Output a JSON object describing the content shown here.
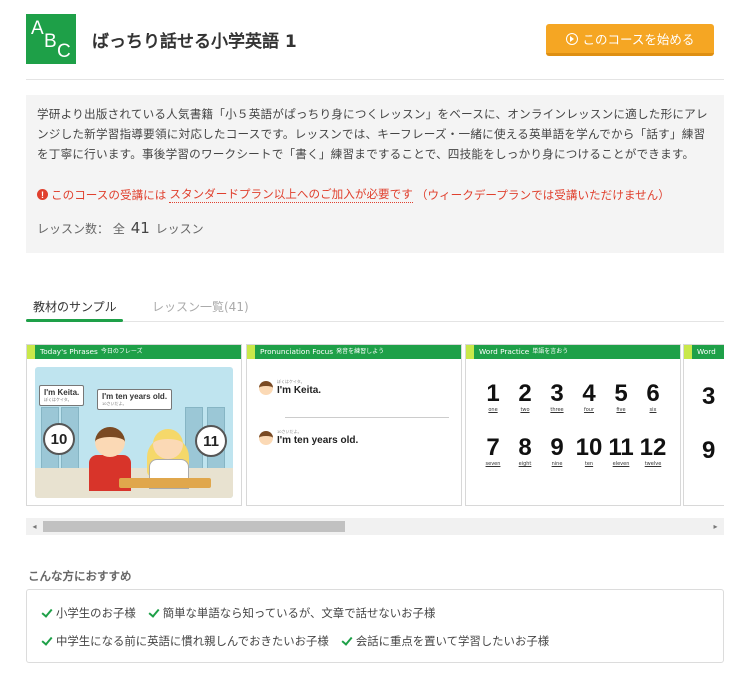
{
  "course": {
    "logo_letters": [
      "A",
      "B",
      "C"
    ],
    "title": "ばっちり話せる小学英語 1",
    "start_button": "このコースを始める",
    "description": "学研より出版されている人気書籍「小５英語がぱっちり身につくレッスン」をベースに、オンラインレッスンに適した形にアレンジした新学習指導要領に対応したコースです。レッスンでは、キーフレーズ・一緒に使える英単語を学んでから「話す」練習を丁寧に行います。事後学習のワークシートで「書く」練習まですることで、四技能をしっかり身につけることができます。",
    "notice_prefix": "このコースの受講には",
    "notice_link": "スタンダードプラン以上へのご加入が必要です",
    "notice_suffix": "（ウィークデープランでは受講いただけません）",
    "lessons_label": "レッスン数：",
    "lessons_prefix": "全",
    "lessons_count": "41",
    "lessons_unit": "レッスン"
  },
  "tabs": {
    "sample": "教材のサンプル",
    "list": "レッスン一覧(41)"
  },
  "slides": [
    {
      "title": "Today's Phrases",
      "subtitle": "今日のフレーズ",
      "bubble1": "I'm Keita.",
      "bubble1_ruby": "ぼくはケイタ。",
      "bubble2": "I'm ten years old.",
      "bubble2_ruby": "10さいだよ。",
      "circle1": "10",
      "circle2": "11"
    },
    {
      "title": "Pronunciation Focus",
      "subtitle": "発音を練習しよう",
      "line1": "I'm Keita.",
      "line1_ruby": "ぼくはケイタ。",
      "line2": "I'm ten years old.",
      "line2_ruby": "10さいだよ。"
    },
    {
      "title": "Word Practice",
      "subtitle": "単語を言おう",
      "row1": [
        {
          "n": "1",
          "w": "one"
        },
        {
          "n": "2",
          "w": "two"
        },
        {
          "n": "3",
          "w": "three"
        },
        {
          "n": "4",
          "w": "four"
        },
        {
          "n": "5",
          "w": "five"
        },
        {
          "n": "6",
          "w": "six"
        }
      ],
      "row2": [
        {
          "n": "7",
          "w": "seven"
        },
        {
          "n": "8",
          "w": "eight"
        },
        {
          "n": "9",
          "w": "nine"
        },
        {
          "n": "10",
          "w": "ten"
        },
        {
          "n": "11",
          "w": "eleven"
        },
        {
          "n": "12",
          "w": "twelve"
        }
      ]
    },
    {
      "title": "Word",
      "n1": "3",
      "n2": "9"
    }
  ],
  "recommend": {
    "title": "こんな方におすすめ",
    "items": [
      "小学生のお子様",
      "簡単な単語なら知っているが、文章で話せないお子様",
      "中学生になる前に英語に慣れ親しんでおきたいお子様",
      "会話に重点を置いて学習したいお子様"
    ]
  },
  "colors": {
    "brand_green": "#1ea048",
    "start_orange": "#f5a623",
    "notice_red": "#e0402e"
  },
  "icons": {
    "start": "play-circle-icon",
    "notice": "exclamation-circle-icon",
    "check": "check-icon",
    "scroll_left": "triangle-left-icon",
    "scroll_right": "triangle-right-icon"
  }
}
